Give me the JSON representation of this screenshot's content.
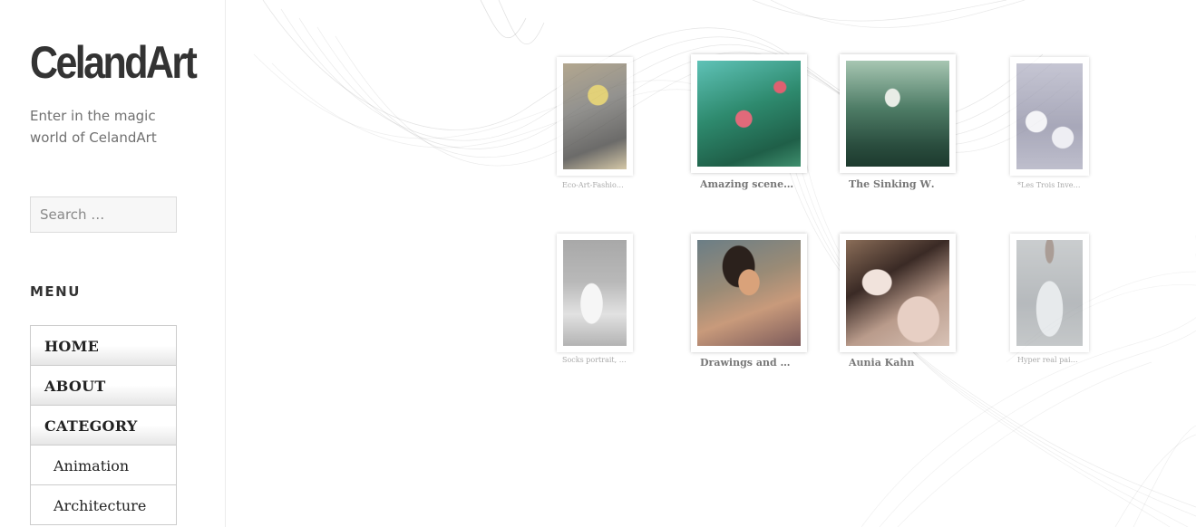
{
  "site": {
    "title": "CelandArt",
    "description": "Enter in the magic world of CelandArt"
  },
  "search": {
    "placeholder": "Search …"
  },
  "menu": {
    "heading": "MENU",
    "items": [
      {
        "label": "HOME"
      },
      {
        "label": "ABOUT"
      },
      {
        "label": "CATEGORY"
      },
      {
        "label": "Animation"
      },
      {
        "label": "Architecture"
      }
    ]
  },
  "gallery": {
    "items": [
      {
        "caption": "Eco-Art-Fashio…"
      },
      {
        "caption": "Amazing scene…"
      },
      {
        "caption": "The Sinking W…"
      },
      {
        "caption": "*Les Trois Inve…"
      },
      {
        "caption": "Socks portrait, …"
      },
      {
        "caption": "Drawings and …"
      },
      {
        "caption": "Aunia Kahn"
      },
      {
        "caption": "Hyper real pai…"
      }
    ]
  },
  "colors": {
    "title": "#333333",
    "description": "#707070",
    "menu_border": "#cccccc",
    "smoke": "#555555"
  }
}
